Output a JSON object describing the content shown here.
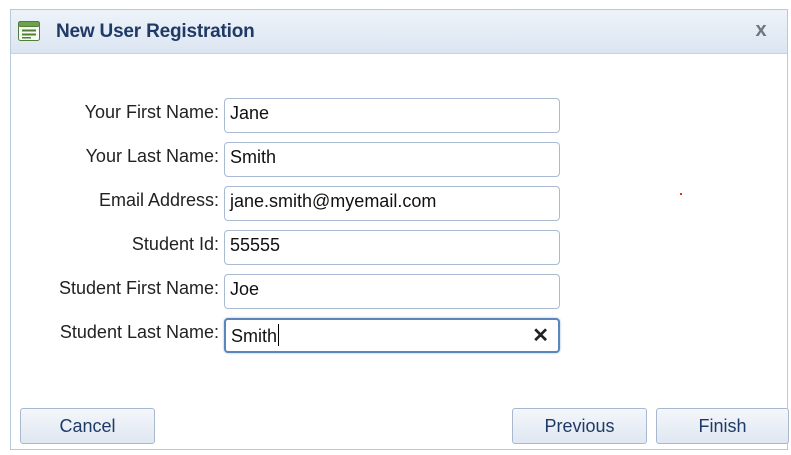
{
  "dialog": {
    "title": "New User Registration",
    "close_label": "x"
  },
  "form": {
    "fields": [
      {
        "label": "Your First Name:",
        "value": "Jane"
      },
      {
        "label": "Your Last Name:",
        "value": "Smith"
      },
      {
        "label": "Email Address:",
        "value": "jane.smith@myemail.com"
      },
      {
        "label": "Student Id:",
        "value": "55555"
      },
      {
        "label": "Student First Name:",
        "value": "Joe"
      },
      {
        "label": "Student Last Name:",
        "value": "Smith"
      }
    ],
    "clear_label": "✕"
  },
  "buttons": {
    "cancel": "Cancel",
    "previous": "Previous",
    "finish": "Finish"
  },
  "colors": {
    "title_text": "#1f3a66",
    "button_text": "#1f3a66",
    "input_border": "#a9bbd2",
    "active_border": "#5b86b9"
  },
  "icons": {
    "title": "form-window-icon",
    "close": "close-icon",
    "clear": "clear-icon"
  }
}
